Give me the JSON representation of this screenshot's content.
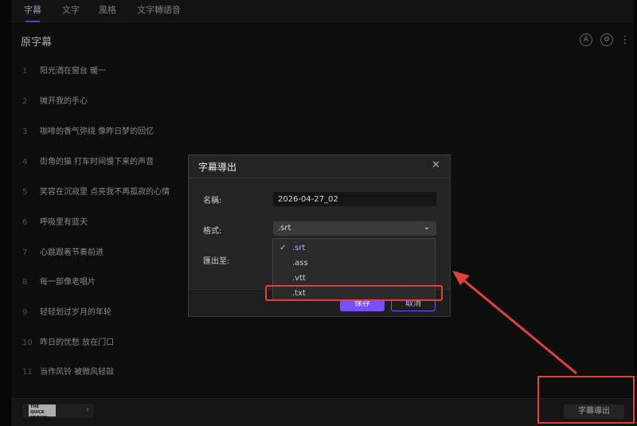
{
  "tabs": [
    {
      "label": "字幕",
      "active": true
    },
    {
      "label": "文字",
      "active": false
    },
    {
      "label": "風格",
      "active": false
    },
    {
      "label": "文字轉語音",
      "active": false
    }
  ],
  "panel": {
    "title": "原字幕",
    "icons": [
      "auto-icon",
      "settings-icon",
      "more-icon"
    ]
  },
  "subtitles": [
    {
      "num": "1",
      "text": "阳光洒在窗台 暖一"
    },
    {
      "num": "2",
      "text": "摊开我的手心"
    },
    {
      "num": "3",
      "text": "咖啡的香气弥绕 像昨日梦的回忆"
    },
    {
      "num": "4",
      "text": "街角的猫 打车时间慢下来的声音"
    },
    {
      "num": "5",
      "text": "笑容在沉寂里 点亮我不再孤寂的心情"
    },
    {
      "num": "6",
      "text": "呼吸里有蓝天"
    },
    {
      "num": "7",
      "text": "心跳跟着节奏前进"
    },
    {
      "num": "8",
      "text": "每一部像老唱片"
    },
    {
      "num": "9",
      "text": "轻轻划过岁月的年轮"
    },
    {
      "num": "10",
      "text": "昨日的忧愁 放在门口"
    },
    {
      "num": "11",
      "text": "当作风铃 被微风轻敲"
    }
  ],
  "bottom": {
    "logo_text": "THE QUICK BROWN FOX",
    "export_label": "字幕導出"
  },
  "dialog": {
    "title": "字幕導出",
    "name_label": "名稱:",
    "name_value": "2026-04-27_02",
    "format_label": "格式:",
    "format_value": ".srt",
    "export_to_label": "匯出至:",
    "save_label": "保存",
    "cancel_label": "取消",
    "options": [
      ".srt",
      ".ass",
      ".vtt",
      ".txt"
    ],
    "selected_option": ".srt"
  },
  "colors": {
    "accent": "#8e5cff",
    "annotation": "#e0413a"
  }
}
